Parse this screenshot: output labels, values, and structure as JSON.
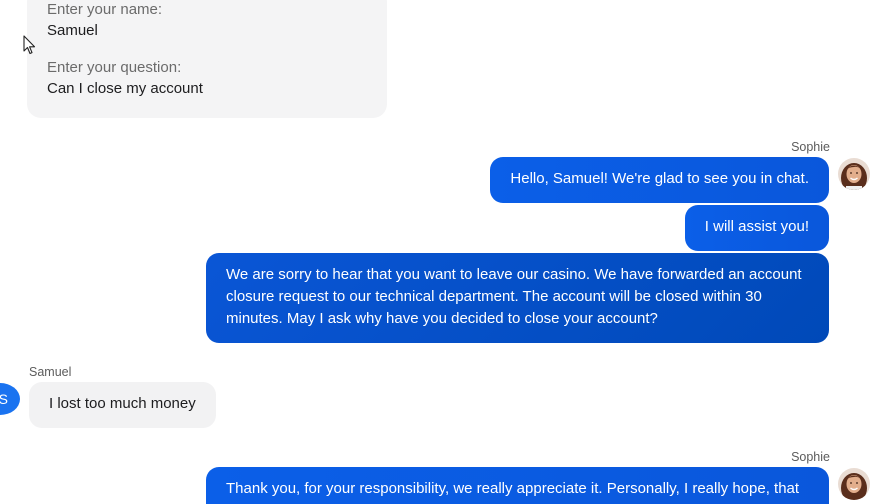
{
  "form": {
    "name_label": "Enter your name:",
    "name_value": "Samuel",
    "question_label": "Enter your question:",
    "question_value": "Can I close my account"
  },
  "messages": [
    {
      "sender": "Sophie",
      "text": "Hello, Samuel! We're glad to see you in chat."
    },
    {
      "sender": "",
      "text": "I will assist you!"
    },
    {
      "sender": "",
      "text": "We are sorry to hear that you want to leave our casino. We have forwarded an account closure request to our technical department. The account will be closed within 30 minutes. May I ask why have you decided to close your account?"
    },
    {
      "sender": "Samuel",
      "text": "I lost too much money"
    },
    {
      "sender": "Sophie",
      "text": "Thank you, for your responsibility, we really appreciate it. Personally, I really hope, that"
    }
  ],
  "avatars": {
    "user_initial": "S"
  },
  "colors": {
    "agent_bubble": "#0a5be0",
    "agent_bubble_dark": "#004cbc",
    "user_bubble": "#f2f2f3",
    "form_card": "#f4f4f5",
    "user_avatar": "#1a73f0"
  },
  "icons": [
    "cursor-icon",
    "agent-avatar",
    "user-avatar"
  ]
}
